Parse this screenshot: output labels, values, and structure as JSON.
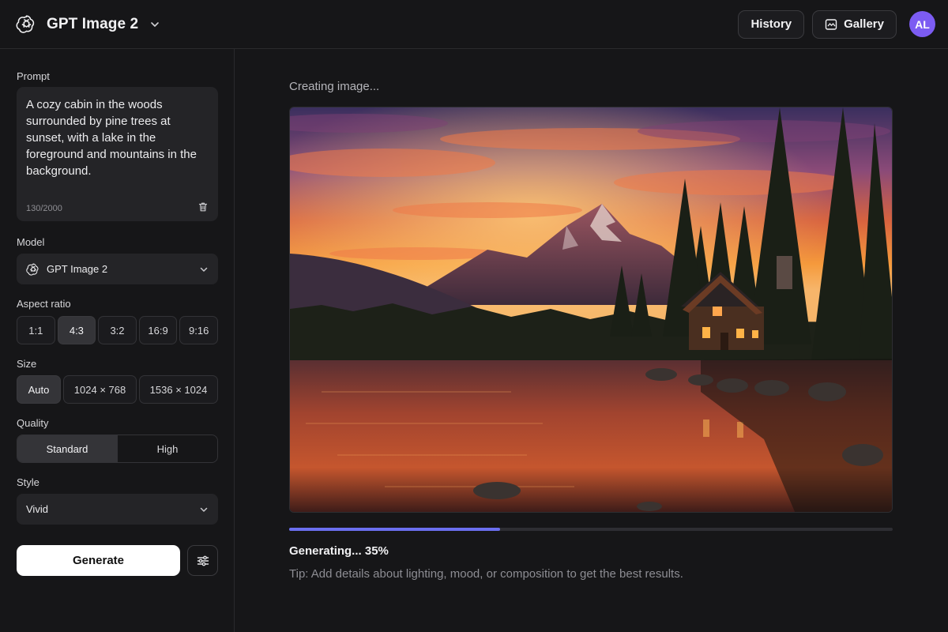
{
  "header": {
    "app_title": "GPT Image 2",
    "history_label": "History",
    "gallery_label": "Gallery",
    "avatar_initials": "AL",
    "avatar_color": "#7c5cf2"
  },
  "sidebar": {
    "prompt_label": "Prompt",
    "prompt_value": "A cozy cabin in the woods surrounded by pine trees at sunset, with a lake in the foreground and mountains in the background.",
    "char_count": "130/2000",
    "model_label": "Model",
    "model_value": "GPT Image 2",
    "aspect_label": "Aspect ratio",
    "aspect_options": [
      "1:1",
      "4:3",
      "3:2",
      "16:9",
      "9:16"
    ],
    "aspect_selected": "4:3",
    "size_label": "Size",
    "size_options": [
      "Auto",
      "1024 × 768",
      "1536 × 1024"
    ],
    "size_selected": "Auto",
    "quality_label": "Quality",
    "quality_options": [
      "Standard",
      "High"
    ],
    "quality_selected": "Standard",
    "style_label": "Style",
    "style_value": "Vivid",
    "generate_label": "Generate"
  },
  "main": {
    "status_text": "Creating image...",
    "progress_percent": 35,
    "progress_color": "#6b6ff0",
    "generating_text": "Generating... 35%",
    "tip_text": "Tip: Add details about lighting, mood, or composition to get the best results."
  }
}
